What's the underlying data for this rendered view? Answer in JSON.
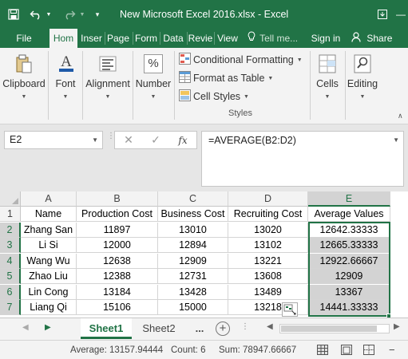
{
  "window": {
    "title": "New Microsoft Excel 2016.xlsx  -  Excel"
  },
  "tabs": [
    "File",
    "Hom",
    "Inser",
    "Page",
    "Form",
    "Data",
    "Revie",
    "View"
  ],
  "tell_me": "Tell me...",
  "signin": "Sign in",
  "share": "Share",
  "ribbon": {
    "clipboard": "Clipboard",
    "font": "Font",
    "alignment": "Alignment",
    "number": "Number",
    "number_icon": "%",
    "conditional_formatting": "Conditional Formatting",
    "format_as_table": "Format as Table",
    "cell_styles": "Cell Styles",
    "styles_group": "Styles",
    "cells": "Cells",
    "editing": "Editing"
  },
  "formula_bar": {
    "name_box": "E2",
    "formula": "=AVERAGE(B2:D2)"
  },
  "sheet": {
    "columns": [
      "A",
      "B",
      "C",
      "D",
      "E"
    ],
    "row_numbers": [
      "1",
      "2",
      "3",
      "4",
      "5",
      "6",
      "7"
    ],
    "headers": [
      "Name",
      "Production Cost",
      "Business Cost",
      "Recruiting Cost",
      "Average Values"
    ],
    "rows": [
      [
        "Zhang San",
        "11897",
        "13010",
        "13020",
        "12642.33333"
      ],
      [
        "Li Si",
        "12000",
        "12894",
        "13102",
        "12665.33333"
      ],
      [
        "Wang Wu",
        "12638",
        "12909",
        "13221",
        "12922.66667"
      ],
      [
        "Zhao Liu",
        "12388",
        "12731",
        "13608",
        "12909"
      ],
      [
        "Lin Cong",
        "13184",
        "13428",
        "13489",
        "13367"
      ],
      [
        "Liang Qi",
        "15106",
        "15000",
        "13218",
        "14441.33333"
      ]
    ]
  },
  "sheet_tabs": [
    "Sheet1",
    "Sheet2"
  ],
  "sheet_more": "...",
  "status": {
    "average": "Average: 13157.94444",
    "count": "Count: 6",
    "sum": "Sum: 78947.66667"
  },
  "colors": {
    "accent": "#217346",
    "selection": "#d3d3d3"
  }
}
